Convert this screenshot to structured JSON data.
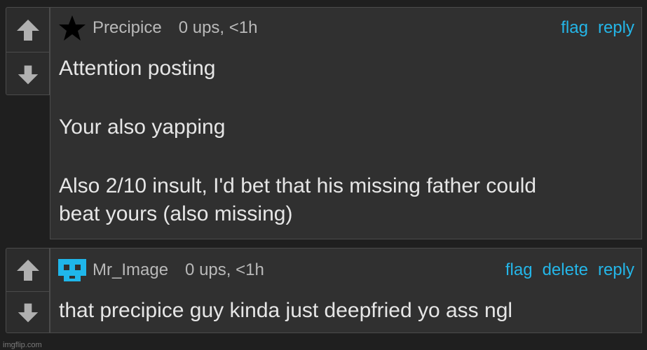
{
  "comments": [
    {
      "username": "Precipice",
      "meta": "0 ups, <1h",
      "actions": [
        "flag",
        "reply"
      ],
      "lines": [
        "Attention posting",
        "",
        "Your also yapping",
        "",
        "Also 2/10 insult, I'd bet that his missing father could",
        "beat yours (also missing)"
      ]
    },
    {
      "username": "Mr_Image",
      "meta": "0 ups, <1h",
      "actions": [
        "flag",
        "delete",
        "reply"
      ],
      "lines": [
        "that precipice guy kinda just deepfried yo ass ngl"
      ]
    }
  ],
  "watermark": "imgflip.com",
  "colors": {
    "link": "#24b6e8",
    "avatar_cyan": "#1fb6ea",
    "vote_arrow": "#b0b0b0"
  },
  "icons": {
    "upvote": "up-arrow-icon",
    "downvote": "down-arrow-icon",
    "avatar_1": "black-star-icon",
    "avatar_2": "cyan-pixel-face-icon"
  }
}
